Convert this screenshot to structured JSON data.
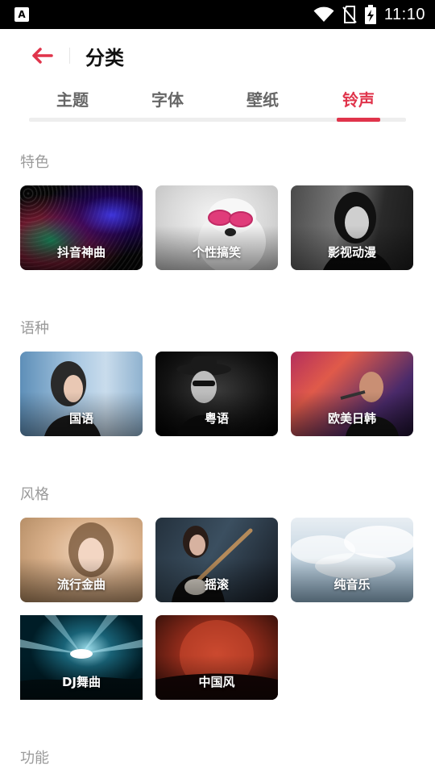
{
  "status_bar": {
    "app_icon_letter": "A",
    "time": "11:10",
    "icons": [
      "wifi-icon",
      "no-sim-icon",
      "battery-charging-icon"
    ]
  },
  "header": {
    "title": "分类"
  },
  "tabs": [
    {
      "label": "主题",
      "active": false
    },
    {
      "label": "字体",
      "active": false
    },
    {
      "label": "壁纸",
      "active": false
    },
    {
      "label": "铃声",
      "active": true
    }
  ],
  "accent_color": "#e0344b",
  "sections": [
    {
      "title": "特色",
      "cards": [
        {
          "label": "抖音神曲"
        },
        {
          "label": "个性搞笑"
        },
        {
          "label": "影视动漫"
        }
      ]
    },
    {
      "title": "语种",
      "cards": [
        {
          "label": "国语"
        },
        {
          "label": "粤语"
        },
        {
          "label": "欧美日韩"
        }
      ]
    },
    {
      "title": "风格",
      "cards": [
        {
          "label": "流行金曲"
        },
        {
          "label": "摇滚"
        },
        {
          "label": "纯音乐"
        },
        {
          "label": "DJ舞曲"
        },
        {
          "label": "中国风"
        }
      ]
    },
    {
      "title": "功能",
      "cards": []
    }
  ]
}
